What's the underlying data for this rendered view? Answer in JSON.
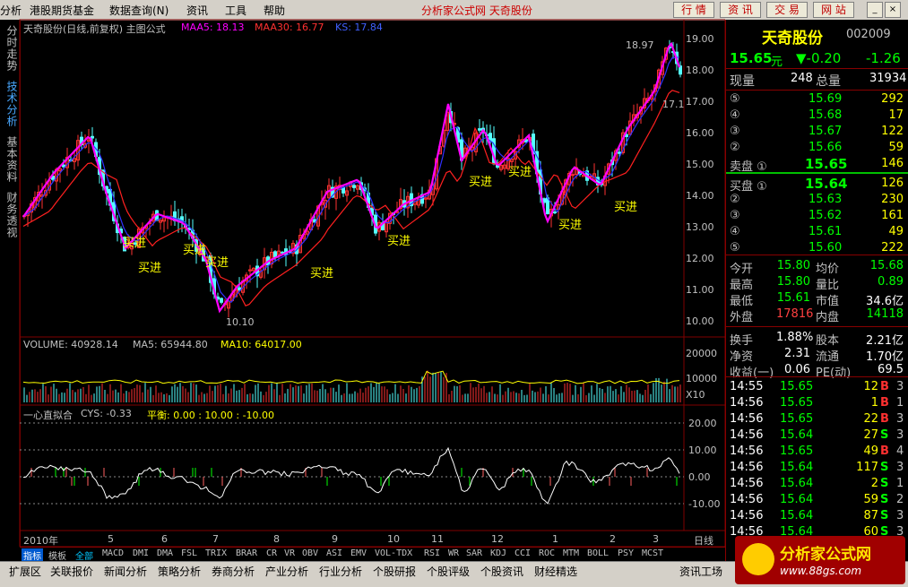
{
  "menu": {
    "items": [
      "分析",
      "港股期货基金",
      "数据查询(N)",
      "资讯",
      "工具",
      "帮助"
    ],
    "center_title": "分析家公式网  天奇股份",
    "buttons": [
      "行 情",
      "资 讯",
      "交 易",
      "网 站"
    ]
  },
  "left_tabs": [
    "分时走势",
    "技术分析",
    "基本资料",
    "财务透视"
  ],
  "chart_header": {
    "name": "天奇股份(日线,前复权) 主图公式",
    "maa5": "MAA5: 18.13",
    "maa30": "MAA30: 16.77",
    "ks": "KS: 17.84"
  },
  "volume_header": {
    "volume": "VOLUME: 40928.14",
    "ma5": "MA5: 65944.80",
    "ma10": "MA10: 64017.00"
  },
  "cys_header": {
    "name": "一心直拟合",
    "cys": "CYS: -0.33",
    "balance": "平衡: 0.00 : 10.00 : -10.00"
  },
  "price_axis": [
    "19.00",
    "18.00",
    "17.00",
    "16.00",
    "15.00",
    "14.00",
    "13.00",
    "12.00",
    "11.00",
    "10.00"
  ],
  "volume_axis": [
    "20000",
    "10000",
    "X10"
  ],
  "cys_axis": [
    "20.00",
    "10.00",
    "0.00",
    "-10.00"
  ],
  "x_axis": {
    "labels": [
      "2010年",
      "5",
      "6",
      "7",
      "8",
      "9",
      "10",
      "11",
      "12",
      "1",
      "2",
      "3"
    ],
    "period": "日线"
  },
  "annotations": {
    "high": "18.97",
    "low": "10.10",
    "recent": "17.1",
    "buy": "买进"
  },
  "colors": {
    "up": "#ff3232",
    "down": "#54ffff",
    "maa5": "#ff00ff",
    "maa30": "#ff2020",
    "ks": "#3030ff",
    "yellow": "#ffff00"
  },
  "quote": {
    "name": "天奇股份",
    "code": "002009",
    "price": "15.65",
    "unit": "元",
    "change": "▼-0.20",
    "change_pct": "-1.26",
    "now_label": "现量",
    "now_value": "248",
    "total_label": "总量",
    "total_value": "31934",
    "sell": [
      {
        "label": "⑤",
        "price": "15.69",
        "vol": "292"
      },
      {
        "label": "④",
        "price": "15.68",
        "vol": "17"
      },
      {
        "label": "③",
        "price": "15.67",
        "vol": "122"
      },
      {
        "label": "②",
        "price": "15.66",
        "vol": "59"
      },
      {
        "label": "卖盘 ①",
        "price": "15.65",
        "vol": "146"
      }
    ],
    "buy": [
      {
        "label": "买盘 ①",
        "price": "15.64",
        "vol": "126"
      },
      {
        "label": "②",
        "price": "15.63",
        "vol": "230"
      },
      {
        "label": "③",
        "price": "15.62",
        "vol": "161"
      },
      {
        "label": "④",
        "price": "15.61",
        "vol": "49"
      },
      {
        "label": "⑤",
        "price": "15.60",
        "vol": "222"
      }
    ],
    "stats": [
      {
        "k1": "今开",
        "v1": "15.80",
        "k2": "均价",
        "v2": "15.68"
      },
      {
        "k1": "最高",
        "v1": "15.80",
        "k2": "量比",
        "v2": "0.89"
      },
      {
        "k1": "最低",
        "v1": "15.61",
        "k2": "市值",
        "v2": "34.6亿"
      },
      {
        "k1": "外盘",
        "v1": "17816",
        "k2": "内盘",
        "v2": "14118"
      }
    ],
    "stats2": [
      {
        "k1": "换手",
        "v1": "1.88%",
        "k2": "股本",
        "v2": "2.21亿"
      },
      {
        "k1": "净资",
        "v1": "2.31",
        "k2": "流通",
        "v2": "1.70亿"
      },
      {
        "k1": "收益(一)",
        "v1": "0.06",
        "k2": "PE(动)",
        "v2": "69.5"
      }
    ],
    "ticks": [
      {
        "t": "14:55",
        "p": "15.65",
        "v": "12",
        "d": "B",
        "n": "3"
      },
      {
        "t": "14:56",
        "p": "15.65",
        "v": "1",
        "d": "B",
        "n": "1"
      },
      {
        "t": "14:56",
        "p": "15.65",
        "v": "22",
        "d": "B",
        "n": "3"
      },
      {
        "t": "14:56",
        "p": "15.64",
        "v": "27",
        "d": "S",
        "n": "3"
      },
      {
        "t": "14:56",
        "p": "15.65",
        "v": "49",
        "d": "B",
        "n": "4"
      },
      {
        "t": "14:56",
        "p": "15.64",
        "v": "117",
        "d": "S",
        "n": "3"
      },
      {
        "t": "14:56",
        "p": "15.64",
        "v": "2",
        "d": "S",
        "n": "1"
      },
      {
        "t": "14:56",
        "p": "15.64",
        "v": "59",
        "d": "S",
        "n": "2"
      },
      {
        "t": "14:56",
        "p": "15.64",
        "v": "87",
        "d": "S",
        "n": "3"
      },
      {
        "t": "14:56",
        "p": "15.64",
        "v": "60",
        "d": "S",
        "n": "3"
      }
    ]
  },
  "bottom_tabs": [
    "指标",
    "模板",
    "全部",
    "MACD",
    "DMI",
    "DMA",
    "FSL",
    "TRIX",
    "BRAR",
    "CR",
    "VR",
    "OBV",
    "ASI",
    "EMV",
    "VOL-TDX",
    "RSI",
    "WR",
    "SAR",
    "KDJ",
    "CCI",
    "ROC",
    "MTM",
    "BOLL",
    "PSY",
    "MCST"
  ],
  "footer_tabs": [
    "扩展区",
    "关联报价",
    "新闻分析",
    "策略分析",
    "券商分析",
    "产业分析",
    "行业分析",
    "个股研报",
    "个股评级",
    "个股资讯",
    "财经精选",
    "资讯工场"
  ],
  "logo": {
    "title": "分析家公式网",
    "url": "www.88gs.com"
  }
}
